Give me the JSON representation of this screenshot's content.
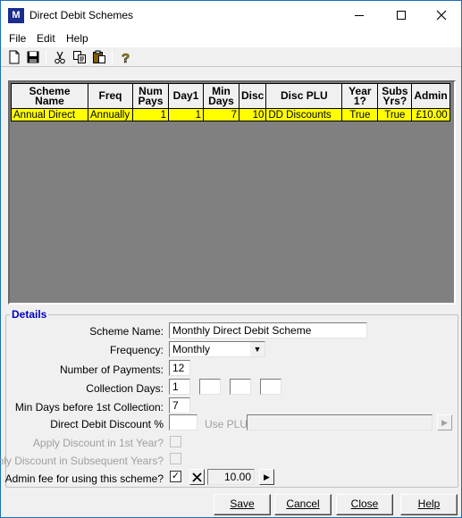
{
  "window": {
    "title": "Direct Debit Schemes",
    "icon_text": "M"
  },
  "menu": {
    "file": "File",
    "edit": "Edit",
    "help": "Help"
  },
  "grid": {
    "headers": [
      "Scheme Name",
      "Freq",
      "Num Pays",
      "Day1",
      "Min Days",
      "Disc",
      "Disc PLU",
      "Year 1?",
      "Subs Yrs?",
      "Admin"
    ],
    "rows": [
      [
        "Annual Direct",
        "Annually",
        "1",
        "1",
        "7",
        "10",
        "DD Discounts",
        "True",
        "True",
        "£10.00"
      ]
    ]
  },
  "details": {
    "group_label": "Details",
    "scheme_name_label": "Scheme Name:",
    "scheme_name_value": "Monthly Direct Debit Scheme",
    "frequency_label": "Frequency:",
    "frequency_value": "Monthly",
    "num_payments_label": "Number of Payments:",
    "num_payments_value": "12",
    "collection_days_label": "Collection Days:",
    "collection_days_values": [
      "1",
      "",
      "",
      ""
    ],
    "min_days_label": "Min Days before 1st Collection:",
    "min_days_value": "7",
    "dd_discount_label": "Direct Debit Discount %",
    "dd_discount_value": "",
    "use_plu_label": "Use PLU:",
    "use_plu_value": "",
    "apply_first_year_label": "Apply Discount in 1st Year?",
    "apply_subsequent_label": "Apply Discount in Subsequent Years?",
    "admin_fee_label": "Admin fee for using this scheme?",
    "admin_fee_checked": "✓",
    "admin_fee_value": "10.00"
  },
  "buttons": {
    "save": "Save",
    "cancel": "Cancel",
    "close": "Close",
    "help": "Help"
  }
}
